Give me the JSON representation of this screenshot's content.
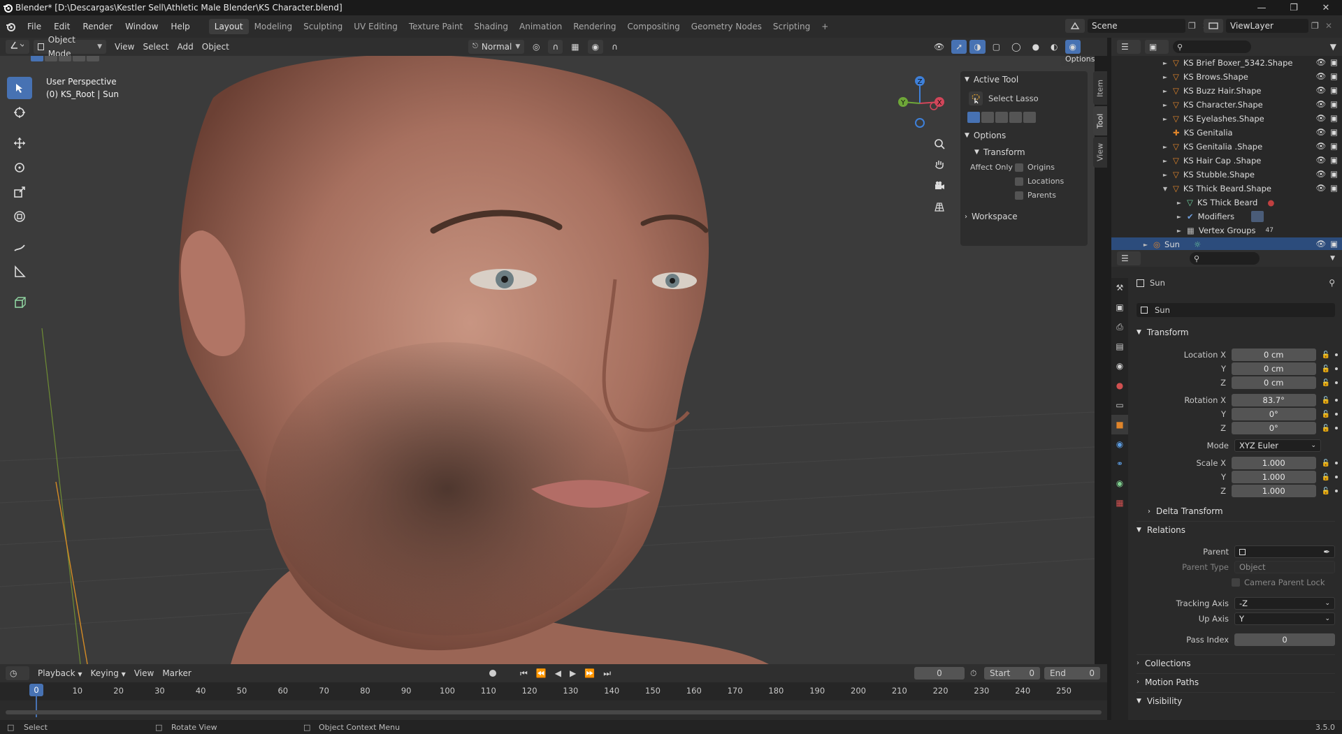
{
  "titlebar": {
    "title": "Blender* [D:\\Descargas\\Kestler Sell\\Athletic Male Blender\\KS Character.blend]"
  },
  "menu": {
    "items": [
      "File",
      "Edit",
      "Render",
      "Window",
      "Help"
    ]
  },
  "workspaces": [
    "Layout",
    "Modeling",
    "Sculpting",
    "UV Editing",
    "Texture Paint",
    "Shading",
    "Animation",
    "Rendering",
    "Compositing",
    "Geometry Nodes",
    "Scripting"
  ],
  "workspace_add": "+",
  "scene": {
    "name": "Scene",
    "view_layer": "ViewLayer"
  },
  "viewport_header": {
    "mode": "Object Mode",
    "menus": [
      "View",
      "Select",
      "Add",
      "Object"
    ],
    "orientation": "Normal",
    "options": "Options"
  },
  "viewport": {
    "perspective": "User Perspective",
    "object_info": "(0) KS_Root | Sun",
    "gizmo_z": "Z",
    "gizmo_y": "Y",
    "gizmo_x": "X"
  },
  "npanel": {
    "tabs": [
      "Item",
      "Tool",
      "View"
    ],
    "active_tool_header": "Active Tool",
    "active_tool": "Select Lasso",
    "options_header": "Options",
    "transform_header": "Transform",
    "affect_only": "Affect Only",
    "origins": "Origins",
    "locations": "Locations",
    "parents": "Parents",
    "workspace": "Workspace"
  },
  "outliner": {
    "rows": [
      {
        "label": "KS Brief Boxer_5342.Shape"
      },
      {
        "label": "KS Brows.Shape"
      },
      {
        "label": "KS Buzz Hair.Shape"
      },
      {
        "label": "KS Character.Shape"
      },
      {
        "label": "KS Eyelashes.Shape"
      },
      {
        "label": "KS Genitalia"
      },
      {
        "label": "KS Genitalia .Shape"
      },
      {
        "label": "KS Hair Cap .Shape"
      },
      {
        "label": "KS Stubble.Shape"
      },
      {
        "label": "KS Thick Beard.Shape"
      },
      {
        "label": "KS Thick Beard"
      },
      {
        "label": "Modifiers"
      },
      {
        "label": "Vertex Groups",
        "count": "47"
      },
      {
        "label": "Sun"
      }
    ]
  },
  "properties": {
    "object_name": "Sun",
    "object_field": "Sun",
    "transform": "Transform",
    "location_x_label": "Location X",
    "location_x": "0 cm",
    "y_label": "Y",
    "location_y": "0 cm",
    "z_label": "Z",
    "location_z": "0 cm",
    "rotation_x_label": "Rotation X",
    "rotation_x": "83.7°",
    "rotation_y": "0°",
    "rotation_z": "0°",
    "mode_label": "Mode",
    "mode": "XYZ Euler",
    "scale_x_label": "Scale X",
    "scale_x": "1.000",
    "scale_y": "1.000",
    "scale_z": "1.000",
    "delta_transform": "Delta Transform",
    "relations": "Relations",
    "parent_label": "Parent",
    "parent_type_label": "Parent Type",
    "parent_type": "Object",
    "camera_parent_lock": "Camera Parent Lock",
    "tracking_axis_label": "Tracking Axis",
    "tracking_axis": "-Z",
    "up_axis_label": "Up Axis",
    "up_axis": "Y",
    "pass_index_label": "Pass Index",
    "pass_index": "0",
    "collections": "Collections",
    "motion_paths": "Motion Paths",
    "visibility": "Visibility"
  },
  "timeline": {
    "menus": [
      "Playback",
      "Keying",
      "View",
      "Marker"
    ],
    "current_frame": "0",
    "start_label": "Start",
    "start": "0",
    "end_label": "End",
    "end": "0",
    "ticks": [
      "0",
      "10",
      "20",
      "30",
      "40",
      "50",
      "60",
      "70",
      "80",
      "90",
      "100",
      "110",
      "120",
      "130",
      "140",
      "150",
      "160",
      "170",
      "180",
      "190",
      "200",
      "210",
      "220",
      "230",
      "240",
      "250"
    ]
  },
  "statusbar": {
    "select": "Select",
    "rotate": "Rotate View",
    "context": "Object Context Menu",
    "version": "3.5.0"
  },
  "colors": {
    "accent": "#4772b3",
    "selection": "#2c4c7c",
    "object_orange": "#e0852a"
  }
}
